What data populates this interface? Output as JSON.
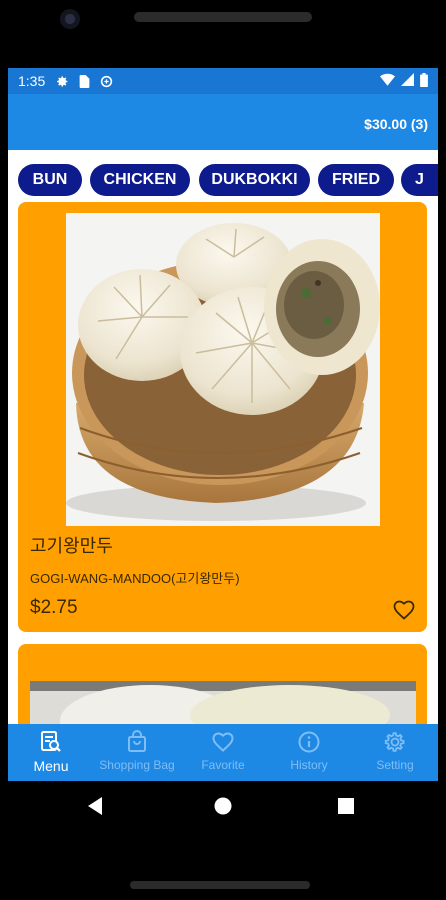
{
  "status_bar": {
    "time": "1:35",
    "left_icons": [
      "gear-icon",
      "sim-card-icon",
      "sync-icon"
    ],
    "right_icons": [
      "wifi-icon",
      "signal-icon",
      "battery-icon"
    ]
  },
  "header": {
    "cart_total": "$30.00 (3)"
  },
  "categories": [
    {
      "label": "BUN"
    },
    {
      "label": "CHICKEN"
    },
    {
      "label": "DUKBOKKI"
    },
    {
      "label": "FRIED"
    },
    {
      "label": "J"
    }
  ],
  "items": [
    {
      "name_korean": "고기왕만두",
      "name_romanized": "GOGI-WANG-MANDOO(고기왕만두)",
      "price": "$2.75",
      "favorite_icon": "heart-outline-icon"
    }
  ],
  "bottom_nav": [
    {
      "label": "Menu",
      "icon": "menu-search-icon",
      "active": true
    },
    {
      "label": "Shopping Bag",
      "icon": "shopping-bag-icon",
      "active": false
    },
    {
      "label": "Favorite",
      "icon": "heart-icon",
      "active": false
    },
    {
      "label": "History",
      "icon": "info-icon",
      "active": false
    },
    {
      "label": "Setting",
      "icon": "gear-icon",
      "active": false
    }
  ],
  "colors": {
    "status_bar": "#1976d2",
    "app_bar": "#1e88e5",
    "chip": "#0d1b8c",
    "card": "#ffa000",
    "nav_inactive": "#7fbef5"
  }
}
